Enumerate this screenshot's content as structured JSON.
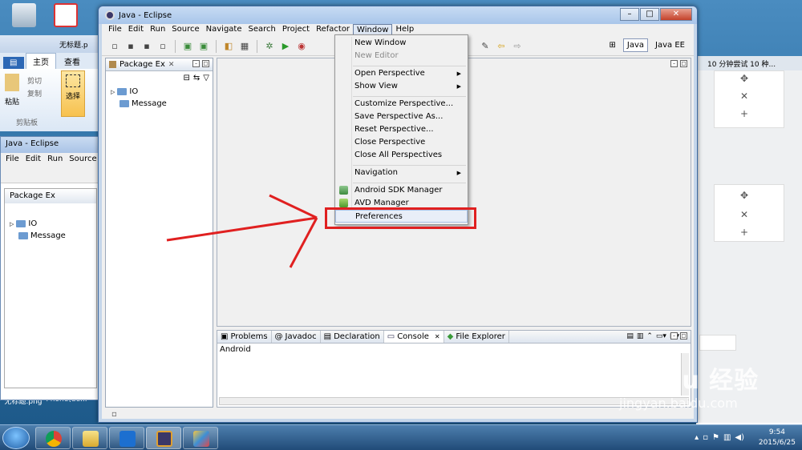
{
  "desktop": {
    "icons": [
      {
        "label": ""
      },
      {
        "label": ""
      },
      {
        "label": "无标题.png"
      },
      {
        "label": "Phone(de..."
      }
    ]
  },
  "background_word": {
    "file_label": "无标题.p",
    "tabs": [
      "主页",
      "查看"
    ],
    "paste_label": "粘贴",
    "cut_label": "剪切",
    "copy_label": "复制",
    "clipboard_group": "剪贴板",
    "select_label": "选择"
  },
  "background_eclipse": {
    "title": "Java - Eclipse",
    "menu": [
      "File",
      "Edit",
      "Run",
      "Source"
    ],
    "view_tab": "Package Ex",
    "tree": [
      "IO",
      "Message"
    ]
  },
  "background_browser": {
    "tab_title": "10 分钟尝试 10 种..."
  },
  "window": {
    "title": "Java - Eclipse",
    "menubar": [
      "File",
      "Edit",
      "Run",
      "Source",
      "Navigate",
      "Search",
      "Project",
      "Refactor",
      "Window",
      "Help"
    ],
    "open_menu": "Window",
    "perspectives": [
      "Java",
      "Java EE"
    ],
    "package_explorer": {
      "tab_label": "Package Ex",
      "items": [
        "IO",
        "Message"
      ]
    },
    "bottom_tabs": [
      "Problems",
      "Javadoc",
      "Declaration",
      "Console",
      "File Explorer"
    ],
    "active_bottom_tab": "Console",
    "console_text": "Android"
  },
  "window_menu": {
    "items": [
      {
        "label": "New Window",
        "enabled": true
      },
      {
        "label": "New Editor",
        "enabled": false
      },
      {
        "label": "Open Perspective",
        "submenu": true
      },
      {
        "label": "Show View",
        "submenu": true
      },
      {
        "label": "Customize Perspective..."
      },
      {
        "label": "Save Perspective As..."
      },
      {
        "label": "Reset Perspective..."
      },
      {
        "label": "Close Perspective"
      },
      {
        "label": "Close All Perspectives"
      },
      {
        "label": "Navigation",
        "submenu": true
      },
      {
        "label": "Android SDK Manager",
        "icon": "android-sdk-icon"
      },
      {
        "label": "AVD Manager",
        "icon": "avd-icon"
      },
      {
        "label": "Preferences",
        "highlighted": true
      }
    ]
  },
  "taskbar": {
    "time": "9:54",
    "date": "2015/6/25"
  },
  "watermark": {
    "text": "Bai du 经验",
    "url": "jingyan.baidu.com"
  },
  "colors": {
    "annotation_red": "#e02020",
    "menu_bg": "#f0f0f0"
  }
}
